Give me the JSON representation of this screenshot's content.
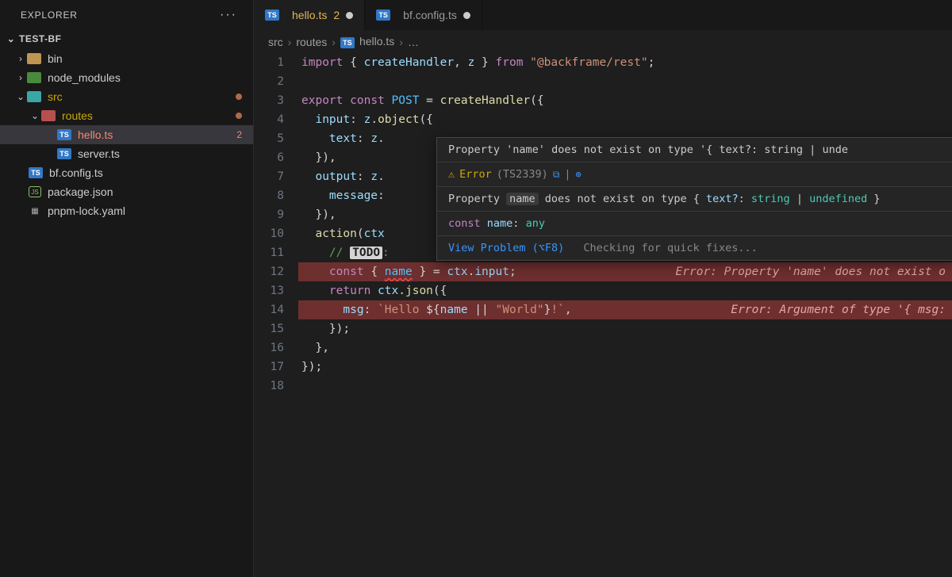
{
  "explorer": {
    "title": "EXPLORER",
    "section": "TEST-BF"
  },
  "tree": [
    {
      "name": "bin",
      "depth": 0,
      "chev": "›",
      "ico": "folder-closed"
    },
    {
      "name": "node_modules",
      "depth": 0,
      "chev": "›",
      "ico": "folder-sub"
    },
    {
      "name": "src",
      "depth": 0,
      "chev": "⌄",
      "ico": "folder-cyan",
      "warn": true,
      "dot": true
    },
    {
      "name": "routes",
      "depth": 1,
      "chev": "⌄",
      "ico": "folder-red",
      "warn": true,
      "dot": true
    },
    {
      "name": "hello.ts",
      "depth": 2,
      "ico": "ts",
      "active": true,
      "error": true,
      "badge": "2"
    },
    {
      "name": "server.ts",
      "depth": 2,
      "ico": "ts"
    },
    {
      "name": "bf.config.ts",
      "depth": 0,
      "ico": "ts"
    },
    {
      "name": "package.json",
      "depth": 0,
      "ico": "json"
    },
    {
      "name": "pnpm-lock.yaml",
      "depth": 0,
      "ico": "lock"
    }
  ],
  "tabs": [
    {
      "icon": "ts",
      "label": "hello.ts",
      "count": "2",
      "dirty": true,
      "active": true
    },
    {
      "icon": "ts",
      "label": "bf.config.ts",
      "dirty": true
    }
  ],
  "crumbs": [
    "src",
    "routes",
    "hello.ts",
    "…"
  ],
  "code": [
    {
      "n": 1,
      "h": "<span class='c-kw'>import</span> <span class='c-pn'>{</span> <span class='c-var'>createHandler</span><span class='c-pn'>,</span> <span class='c-var'>z</span> <span class='c-pn'>}</span> <span class='c-kw'>from</span> <span class='c-str'>\"@backframe/rest\"</span><span class='c-pn'>;</span>"
    },
    {
      "n": 2,
      "h": ""
    },
    {
      "n": 3,
      "h": "<span class='c-kw'>export</span> <span class='c-kw'>const</span> <span class='c-id'>POST</span> <span class='c-pn'>=</span> <span class='c-fn'>createHandler</span><span class='c-pn'>({</span>"
    },
    {
      "n": 4,
      "h": "  <span class='c-var'>input</span><span class='c-pn'>:</span> <span class='c-var'>z</span><span class='c-pn'>.</span><span class='c-fn'>object</span><span class='c-pn'>({</span>"
    },
    {
      "n": 5,
      "h": "    <span class='c-var'>text</span><span class='c-pn'>:</span> <span class='c-var'>z</span><span class='c-pn'>.</span>"
    },
    {
      "n": 6,
      "h": "  <span class='c-pn'>}),</span>"
    },
    {
      "n": 7,
      "h": "  <span class='c-var'>output</span><span class='c-pn'>:</span> <span class='c-var'>z</span><span class='c-pn'>.</span>"
    },
    {
      "n": 8,
      "h": "    <span class='c-var'>message</span><span class='c-pn'>:</span>"
    },
    {
      "n": 9,
      "h": "  <span class='c-pn'>}),</span>"
    },
    {
      "n": 10,
      "h": "  <span class='c-fn'>action</span><span class='c-pn'>(</span><span class='c-var'>ctx</span>"
    },
    {
      "n": 11,
      "h": "    <span class='c-cm'>// </span><span class='todo-tag'>TODO</span><span class='c-cm'>:</span>"
    },
    {
      "n": 12,
      "h": "    <span class='c-kw'>const</span> <span class='c-pn'>{</span> <span class='c-id sq-under'>name</span> <span class='c-pn'>}</span> <span class='c-pn'>=</span> <span class='c-var'>ctx</span><span class='c-pn'>.</span><span class='c-var'>input</span><span class='c-pn'>;</span>",
      "err": "Error: Property 'name' does not exist o"
    },
    {
      "n": 13,
      "h": "    <span class='c-kw'>return</span> <span class='c-var'>ctx</span><span class='c-pn'>.</span><span class='c-fn'>json</span><span class='c-pn'>({</span>"
    },
    {
      "n": 14,
      "h": "      <span class='c-var'>msg</span><span class='c-pn'>:</span> <span class='c-str'>`Hello </span><span class='c-pn'>${</span><span class='c-var'>name</span> <span class='c-pn'>||</span> <span class='c-str'>\"World\"</span><span class='c-pn'>}</span><span class='c-str'>!`</span><span class='c-pn'>,</span>",
      "err": "Error: Argument of type '{ msg:"
    },
    {
      "n": 15,
      "h": "    <span class='c-pn'>});</span>"
    },
    {
      "n": 16,
      "h": "  <span class='c-pn'>},</span>"
    },
    {
      "n": 17,
      "h": "<span class='c-pn'>});</span>"
    },
    {
      "n": 18,
      "h": ""
    }
  ],
  "hover": {
    "headline_pre": "Property ",
    "headline_name": "'name'",
    "headline_mid": " does not exist on type ",
    "headline_type": "'{ text?: string | unde",
    "err_label": "Error",
    "err_code": "(TS2339)",
    "detail_pre": "Property ",
    "detail_name": "name",
    "detail_mid": " does not exist on type ",
    "detail_type_open": "{ ",
    "detail_key": "text?",
    "detail_colon": ": ",
    "detail_ty": "string",
    "detail_pipe": " | ",
    "detail_undef": "undefined",
    "detail_close": " }",
    "sig": "const name: any",
    "view_problem": "View Problem (⌥F8)",
    "quickfix": "Checking for quick fixes..."
  }
}
